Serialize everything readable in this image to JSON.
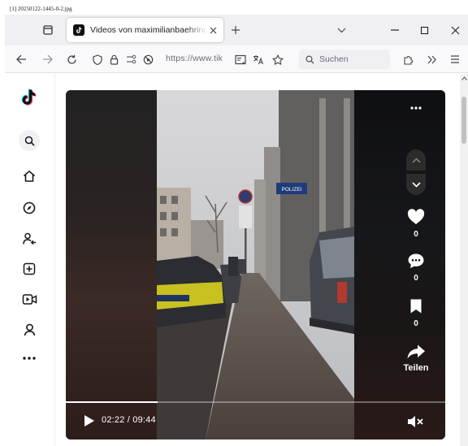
{
  "screenshot_label": "[1] 20250122-1445-0-2.jpg",
  "browser": {
    "tab": {
      "title": "Videos von maximilianbaehring"
    },
    "url_display": "https://www.tik",
    "search_placeholder": "Suchen"
  },
  "tiktok": {
    "sidebar_items": [
      "search-icon",
      "home-icon",
      "explore-icon",
      "following-icon",
      "upload-icon",
      "live-icon",
      "profile-icon",
      "more-icon"
    ],
    "video": {
      "street_sign": "POLIZEI",
      "like_count": "0",
      "comment_count": "0",
      "save_count": "0",
      "share_label": "Teilen",
      "time_display": "02:22 / 09:44",
      "progress": 0.242
    }
  },
  "colors": {
    "tab_bar": "#f0f0f4",
    "nav_bar": "#f9f9fb",
    "video_bg": "#111111",
    "accent": "#ffffff"
  }
}
